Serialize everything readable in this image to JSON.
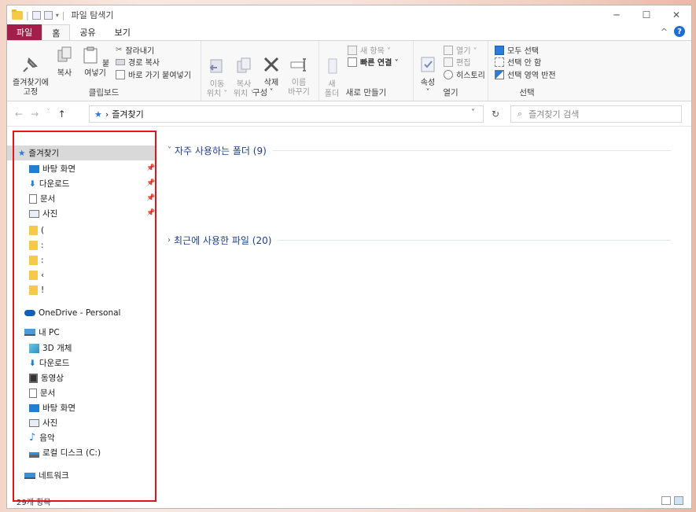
{
  "window": {
    "title": "파일 탐색기",
    "qa_sep": "|",
    "minimize": "─",
    "maximize": "☐",
    "close": "✕"
  },
  "ribbon_tabs": {
    "file": "파일",
    "home": "홈",
    "share": "공유",
    "view": "보기",
    "collapse": "^",
    "help": "?"
  },
  "ribbon": {
    "clipboard": {
      "label": "클립보드",
      "pin_quick": "즐겨찾기에\n고정",
      "copy": "복사",
      "paste": "붙여넣기",
      "cut": "잘라내기",
      "copy_path": "경로 복사",
      "paste_shortcut": "바로 가기 붙여넣기"
    },
    "organize": {
      "label": "구성",
      "move_to": "이동\n위치 ˅",
      "copy_to": "복사\n위치 ˅",
      "delete": "삭제\n˅",
      "rename": "이름\n바꾸기"
    },
    "new": {
      "label": "새로 만들기",
      "new_folder": "새\n폴더",
      "new_item": "새 항목 ˅",
      "easy_access": "빠른 연결 ˅"
    },
    "open": {
      "label": "열기",
      "properties": "속성\n˅",
      "open": "열기 ˅",
      "edit": "편집",
      "history": "히스토리"
    },
    "select": {
      "label": "선택",
      "select_all": "모두 선택",
      "select_none": "선택 안 함",
      "invert": "선택 영역 반전"
    }
  },
  "address": {
    "back": "←",
    "forward": "→",
    "recent": "˅",
    "up": "↑",
    "path": "즐겨찾기",
    "path_sep": "›",
    "dropdown": "˅",
    "refresh": "↻",
    "search_placeholder": "즐겨찾기 검색"
  },
  "nav_pane": {
    "quick_access": "즐겨찾기",
    "qa_items": [
      "바탕 화면",
      "다운로드",
      "문서",
      "사진"
    ],
    "qa_pins": [
      "📌",
      "📌",
      "📌",
      "📌"
    ],
    "qa_folders": [
      "(",
      ":",
      ":",
      "‹",
      "!"
    ],
    "onedrive": "OneDrive - Personal",
    "this_pc": "내 PC",
    "pc_items": [
      "3D 개체",
      "다운로드",
      "동영상",
      "문서",
      "바탕 화면",
      "사진",
      "음악",
      "로컬 디스크 (C:)"
    ],
    "network": "네트워크"
  },
  "content": {
    "frequent": "자주 사용하는 폴더 (9)",
    "recent": "최근에 사용한 파일 (20)",
    "chev_open": "˅",
    "chev_closed": "›"
  },
  "status": {
    "count": "29개 항목"
  },
  "colors": {
    "file_tab": "#a31e4a",
    "highlight": "#e0161b",
    "section": "#1e3f8a",
    "folder": "#f7c948"
  }
}
